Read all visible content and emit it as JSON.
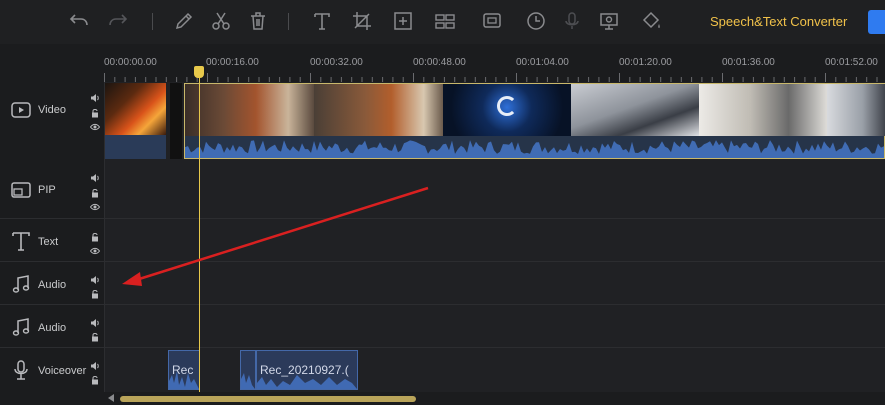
{
  "toolbar": {
    "speech_label": "Speech&Text Converter",
    "icons": [
      "undo-icon",
      "redo-icon",
      "pen-icon",
      "scissors-icon",
      "trash-icon",
      "text-icon",
      "crop-icon",
      "fit-icon",
      "split-icon",
      "pip-icon",
      "clock-icon",
      "mic-icon",
      "screen-record-icon",
      "paint-bucket-icon"
    ],
    "accent": "#f1c24a",
    "export_color": "#2f7bf0"
  },
  "ruler": {
    "labels": [
      "00:00:00.00",
      "00:00:16.00",
      "00:00:32.00",
      "00:00:48.00",
      "00:01:04.00",
      "00:01:20.00",
      "00:01:36.00",
      "00:01:52.00"
    ]
  },
  "tracks": [
    {
      "label": "Video",
      "icon": "video-track-icon"
    },
    {
      "label": "PIP",
      "icon": "pip-track-icon"
    },
    {
      "label": "Text",
      "icon": "text-track-icon"
    },
    {
      "label": "Audio",
      "icon": "music-note-icon"
    },
    {
      "label": "Audio",
      "icon": "music-note-icon"
    },
    {
      "label": "Voiceover",
      "icon": "microphone-icon"
    }
  ],
  "voiceover_clips": [
    {
      "label": "Rec"
    },
    {
      "label": "Rec_20210927.("
    }
  ],
  "colors": {
    "playhead": "#e8c94b",
    "annotation_arrow": "#d92020",
    "clip_border": "#c9b86b",
    "waveform": "#4a7fd8"
  }
}
